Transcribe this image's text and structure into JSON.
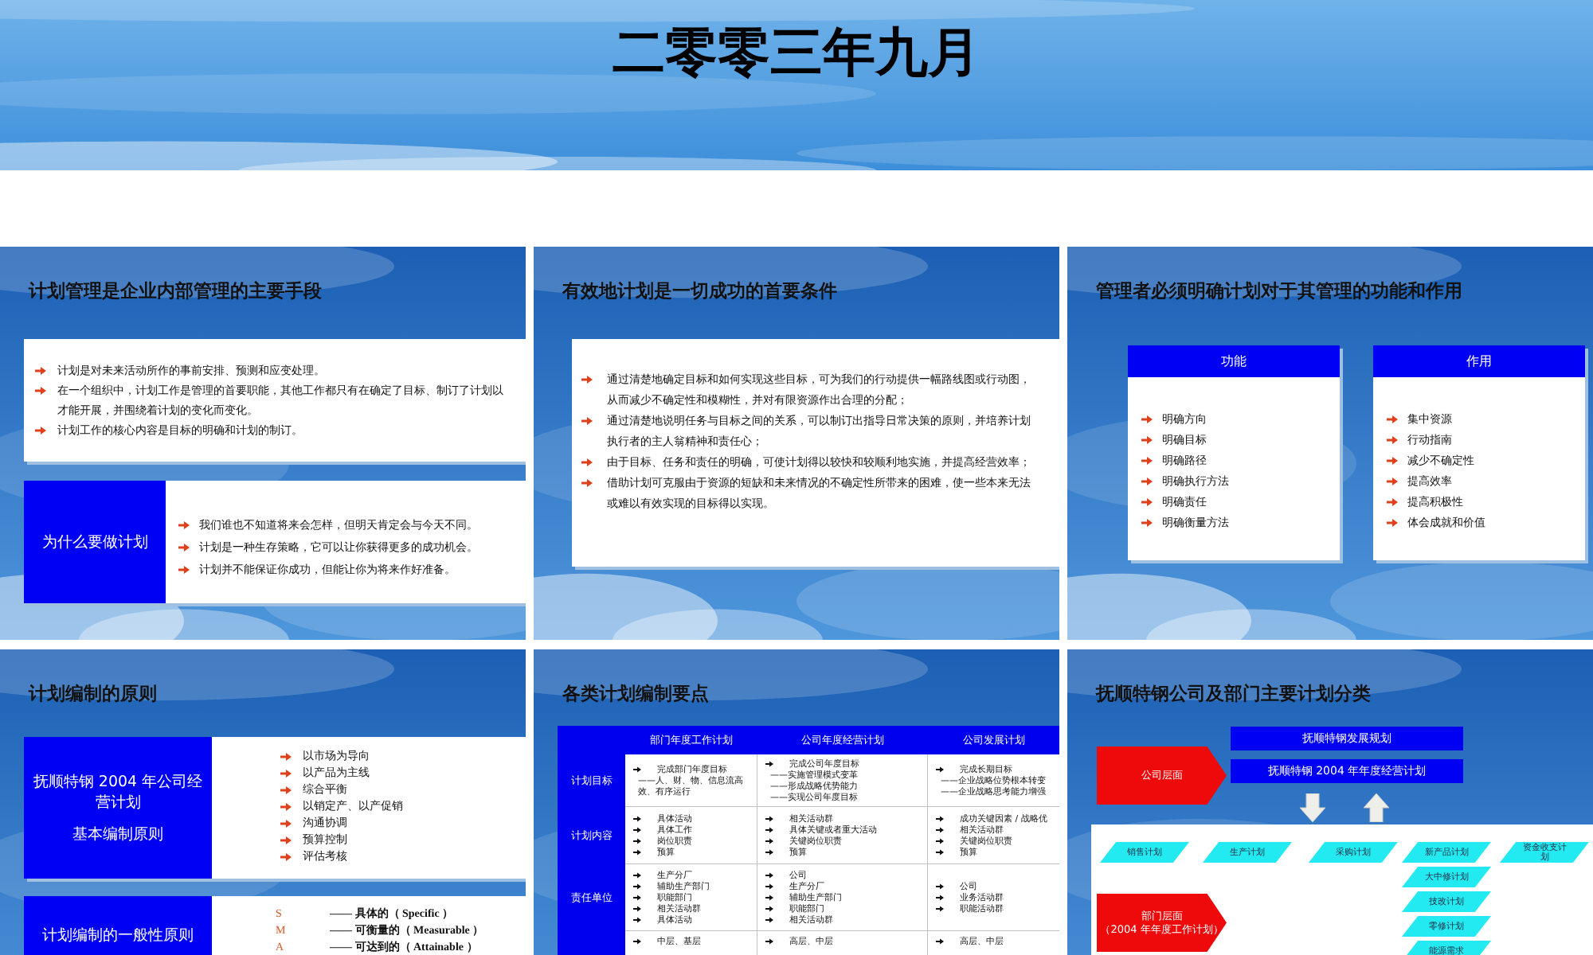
{
  "title_slide": {
    "subtitle": "二零零三年九月"
  },
  "slides": [
    {
      "kind": "panel_callout",
      "title": "计划管理是企业内部管理的主要手段",
      "bullets": [
        {
          "lines": [
            "计划是对未来活动所作的事前安排、预测和应变处理。"
          ]
        },
        {
          "lines": [
            "在一个组织中，计划工作是管理的首要职能，其他工作都只有在确定了目标、制订了计划以",
            "才能开展，并围绕着计划的变化而变化。"
          ]
        },
        {
          "lines": [
            "计划工作的核心内容是目标的明确和计划的制订。"
          ]
        }
      ],
      "callout": {
        "label": "为什么要做计划",
        "bullets": [
          {
            "lines": [
              "我们谁也不知道将来会怎样，但明天肯定会与今天不同。"
            ]
          },
          {
            "lines": [
              "计划是一种生存策略，它可以让你获得更多的成功机会。"
            ]
          },
          {
            "lines": [
              "计划并不能保证你成功，但能让你为将来作好准备。"
            ]
          }
        ]
      }
    },
    {
      "kind": "panel",
      "title": "有效地计划是一切成功的首要条件",
      "bullets": [
        {
          "lines": [
            "通过清楚地确定目标和如何实现这些目标，可为我们的行动提供一幅路线图或行动图，",
            "从而减少不确定性和模糊性，并对有限资源作出合理的分配；"
          ]
        },
        {
          "lines": [
            "通过清楚地说明任务与目标之间的关系，可以制订出指导日常决策的原则，并培养计划",
            "执行者的主人翁精神和责任心；"
          ]
        },
        {
          "lines": [
            "由于目标、任务和责任的明确，可使计划得以较快和较顺利地实施，并提高经营效率；"
          ]
        },
        {
          "lines": [
            "借助计划可克服由于资源的短缺和未来情况的不确定性所带来的困难，使一些本来无法",
            "或难以有效实现的目标得以实现。"
          ]
        }
      ]
    },
    {
      "kind": "cards",
      "title": "管理者必须明确计划对于其管理的功能和作用",
      "cards": [
        {
          "heading": "功能",
          "items": [
            "明确方向",
            "明确目标",
            "明确路径",
            "明确执行方法",
            "明确责任",
            "明确衡量方法"
          ]
        },
        {
          "heading": "作用",
          "items": [
            "集中资源",
            "行动指南",
            "减少不确定性",
            "提高效率",
            "提高积极性",
            "体会成就和价值"
          ]
        }
      ]
    },
    {
      "kind": "principles",
      "title": "计划编制的原则",
      "boxes": [
        {
          "label_lines": [
            "抚顺特钢 2004 年公司经营计划",
            "基本编制原则"
          ],
          "items": [
            {
              "text": "以市场为导向"
            },
            {
              "text": "以产品为主线"
            },
            {
              "text": "综合平衡"
            },
            {
              "text": "以销定产、以产促销"
            },
            {
              "text": "沟通协调"
            },
            {
              "text": "预算控制"
            },
            {
              "text": "评估考核"
            }
          ]
        },
        {
          "label_lines": [
            "计划编制的一般性原则"
          ],
          "items": [
            {
              "letter": "S",
              "text": "—— 具体的（ Specific ）"
            },
            {
              "letter": "M",
              "text": "—— 可衡量的（ Measurable ）"
            },
            {
              "letter": "A",
              "text": "—— 可达到的（ Attainable ）"
            }
          ]
        }
      ]
    },
    {
      "kind": "table",
      "title": "各类计划编制要点",
      "columns": [
        "部门年度工作计划",
        "公司年度经营计划",
        "公司发展计划"
      ],
      "rows": [
        {
          "label": "计划目标",
          "cells": [
            [
              {
                "text": "完成部门年度目标",
                "arrow": true
              },
              {
                "text": "——人、财、物、信息流高效、有序运行",
                "arrow": false
              }
            ],
            [
              {
                "text": "完成公司年度目标",
                "arrow": true
              },
              {
                "text": "——实施管理模式变革",
                "arrow": false
              },
              {
                "text": "——形成战略优势能力",
                "arrow": false
              },
              {
                "text": "——实现公司年度目标",
                "arrow": false
              }
            ],
            [
              {
                "text": "完成长期目标",
                "arrow": true
              },
              {
                "text": "——企业战略位势根本转变",
                "arrow": false
              },
              {
                "text": "——企业战略思考能力增强",
                "arrow": false
              }
            ]
          ]
        },
        {
          "label": "计划内容",
          "cells": [
            [
              {
                "text": "具体活动",
                "arrow": true
              },
              {
                "text": "具体工作",
                "arrow": true
              },
              {
                "text": "岗位职责",
                "arrow": true
              },
              {
                "text": "预算",
                "arrow": true
              }
            ],
            [
              {
                "text": "相关活动群",
                "arrow": true
              },
              {
                "text": "具体关键或者重大活动",
                "arrow": true
              },
              {
                "text": "关键岗位职责",
                "arrow": true
              },
              {
                "text": "预算",
                "arrow": true
              }
            ],
            [
              {
                "text": "成功关键因素 / 战略优",
                "arrow": true
              },
              {
                "text": "相关活动群",
                "arrow": true
              },
              {
                "text": "关键岗位职责",
                "arrow": true
              },
              {
                "text": "预算",
                "arrow": true
              }
            ]
          ]
        },
        {
          "label": "责任单位",
          "cells": [
            [
              {
                "text": "生产分厂",
                "arrow": true
              },
              {
                "text": "辅助生产部门",
                "arrow": true
              },
              {
                "text": "职能部门",
                "arrow": true
              },
              {
                "text": "相关活动群",
                "arrow": true
              },
              {
                "text": "具体活动",
                "arrow": true
              }
            ],
            [
              {
                "text": "公司",
                "arrow": true
              },
              {
                "text": "生产分厂",
                "arrow": true
              },
              {
                "text": "辅助生产部门",
                "arrow": true
              },
              {
                "text": "职能部门",
                "arrow": true
              },
              {
                "text": "相关活动群",
                "arrow": true
              }
            ],
            [
              {
                "text": "公司",
                "arrow": true
              },
              {
                "text": "业务活动群",
                "arrow": true
              },
              {
                "text": "职能活动群",
                "arrow": true
              }
            ]
          ]
        },
        {
          "cells": [
            [
              {
                "text": "中层、基层",
                "arrow": true
              }
            ],
            [
              {
                "text": "高层、中层",
                "arrow": true
              }
            ],
            [
              {
                "text": "高层、中层",
                "arrow": true
              }
            ]
          ]
        }
      ]
    },
    {
      "kind": "diagram",
      "title": "抚顺特钢公司及部门主要计划分类",
      "bars": [
        "抚顺特钢发展规划",
        "抚顺特钢 2004 年年度经营计划"
      ],
      "levels": [
        {
          "lines": [
            "公司层面"
          ]
        },
        {
          "lines": [
            "部门层面",
            "（2004 年年度工作计划）"
          ]
        }
      ],
      "flow_arrows": [
        {
          "kind": "down"
        },
        {
          "kind": "up"
        }
      ],
      "plan_columns": [
        [
          "销售计划"
        ],
        [
          "生产计划"
        ],
        [
          "采购计划"
        ],
        [
          "新产品计划",
          "大中修计划",
          "技改计划",
          "零修计划",
          "能源需求"
        ],
        [
          "资金收支计划"
        ]
      ]
    }
  ]
}
